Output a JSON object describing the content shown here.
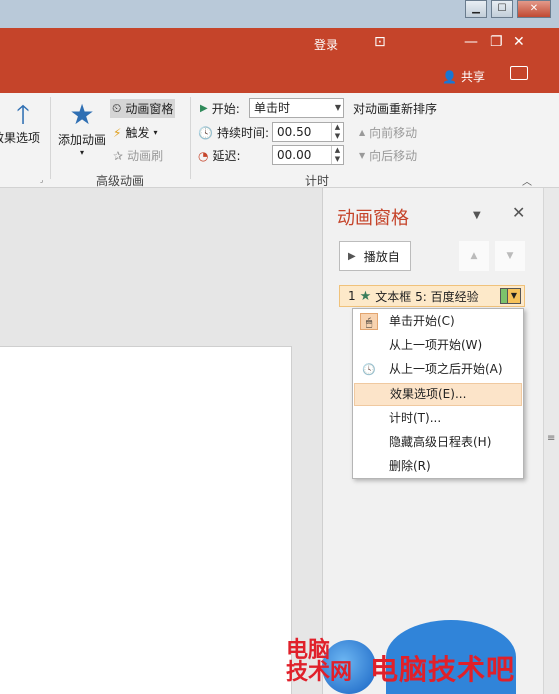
{
  "titlebar": {
    "login": "登录",
    "share": "共享"
  },
  "ribbon": {
    "effect_options": "效果选项",
    "add_animation": "添加动画",
    "animation_pane": "动画窗格",
    "trigger": "触发",
    "animation_painter": "动画刷",
    "group_advanced": "高级动画",
    "start_label": "开始:",
    "start_value": "单击时",
    "duration_label": "持续时间:",
    "duration_value": "00.50",
    "delay_label": "延迟:",
    "delay_value": "00.00",
    "group_timing": "计时",
    "reorder_title": "对动画重新排序",
    "move_earlier": "向前移动",
    "move_later": "向后移动"
  },
  "pane": {
    "title": "动画窗格",
    "play_from": "播放自",
    "item_number": "1",
    "item_label": "文本框 5: 百度经验"
  },
  "menu": {
    "items": [
      {
        "label": "单击开始(C)",
        "icon": "mouse-click-icon"
      },
      {
        "label": "从上一项开始(W)",
        "icon": ""
      },
      {
        "label": "从上一项之后开始(A)",
        "icon": "clock-icon"
      },
      {
        "label": "效果选项(E)...",
        "icon": ""
      },
      {
        "label": "计时(T)...",
        "icon": ""
      },
      {
        "label": "隐藏高级日程表(H)",
        "icon": ""
      },
      {
        "label": "删除(R)",
        "icon": ""
      }
    ]
  },
  "watermark": {
    "small": "电脑",
    "small2": "技术网",
    "big": "电脑技术吧"
  },
  "colors": {
    "accent": "#c5442a",
    "menu_highlight": "#fce4c9"
  }
}
